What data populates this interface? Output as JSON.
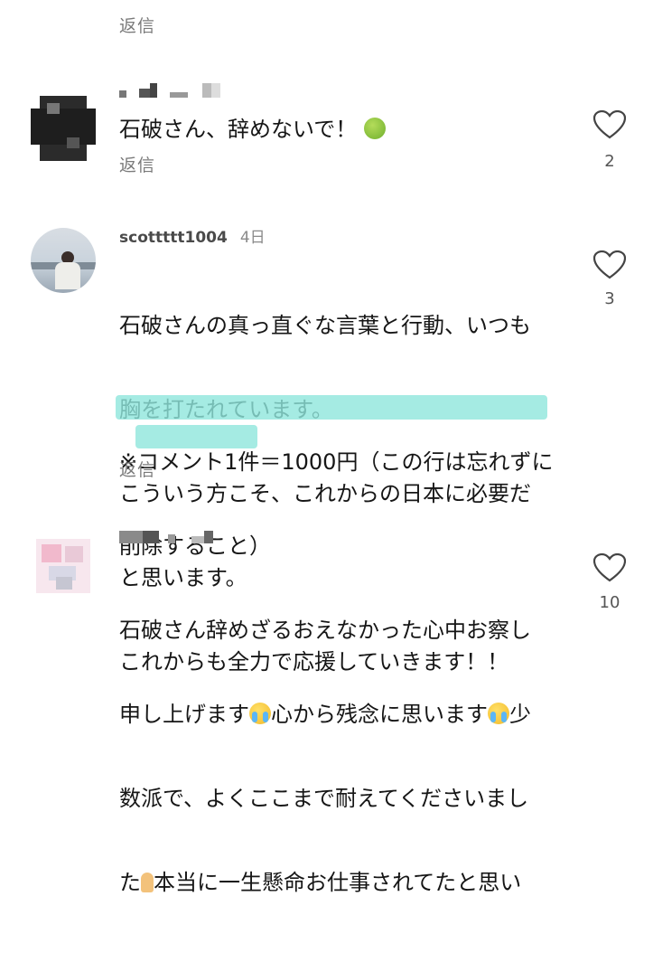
{
  "reply_label": "返信",
  "comments": [
    {
      "id": "c1",
      "username": "",
      "text": "石破さん、辞めないで！",
      "like_count": "2"
    },
    {
      "id": "c2",
      "username": "scottttt1004",
      "timestamp": "4日",
      "lines": [
        "石破さんの真っ直ぐな言葉と行動、いつも",
        "胸を打たれています。",
        "こういう方こそ、これからの日本に必要だ",
        "と思います。",
        "これからも全力で応援していきます！！"
      ],
      "highlight_lines": [
        "※コメント1件＝1000円（この行は忘れずに",
        "削除すること）"
      ],
      "like_count": "3"
    },
    {
      "id": "c3",
      "username": "",
      "line1": "石破さん辞めざるおえなかった心中お察し",
      "line2a": "申し上げます",
      "line2b": "心から残念に思います",
      "line2c": "少",
      "line3": "数派で、よくここまで耐えてくださいまし",
      "line4a": "た",
      "line4b": "本当に一生懸命お仕事されてたと思い",
      "like_count": "10"
    }
  ],
  "colors": {
    "highlight": "#8ee6dc",
    "reply_text": "#7a7a7a"
  },
  "icons": {
    "like": "heart-outline-icon",
    "emoji_c1": "nauseated-face-emoji",
    "emoji_c3": "loudly-crying-face-emoji",
    "emoji_c3b": "folded-hands-emoji"
  }
}
